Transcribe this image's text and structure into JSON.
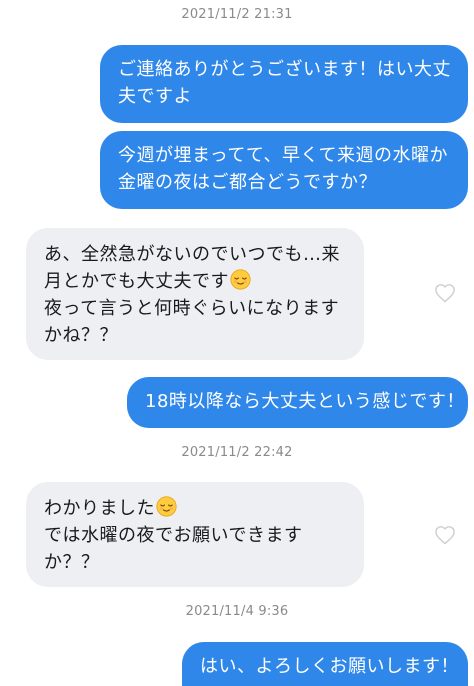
{
  "timestamps": {
    "t1": "2021/11/2 21:31",
    "t2": "2021/11/2 22:42",
    "t3": "2021/11/4 9:36"
  },
  "messages": [
    {
      "sender": "me",
      "lines": [
        "ご連絡ありがとうございます！はい大丈",
        "夫ですよ"
      ]
    },
    {
      "sender": "me",
      "lines": [
        "今週が埋まってて、早くて来週の水曜か",
        "金曜の夜はご都合どうですか？"
      ]
    },
    {
      "sender": "them",
      "lines": [
        "あ、全然急がないのでいつでも…来",
        "月とかでも大丈夫です",
        "夜って言うと何時ぐらいになります",
        "かね？？"
      ]
    },
    {
      "sender": "me",
      "lines": [
        "18時以降なら大丈夫という感じです！"
      ]
    },
    {
      "sender": "them",
      "lines": [
        "わかりました",
        "では水曜の夜でお願いできます",
        "か？？"
      ]
    },
    {
      "sender": "me",
      "lines": [
        "はい、よろしくお願いします！"
      ]
    }
  ],
  "icons": {
    "emoji": "relieved-face-emoji",
    "like": "heart-outline-icon"
  },
  "colors": {
    "outgoing_bubble": "#2f87ea",
    "incoming_bubble": "#edeff2",
    "timestamp_text": "#8a8a8a",
    "heart_outline": "#cfcfcf"
  }
}
